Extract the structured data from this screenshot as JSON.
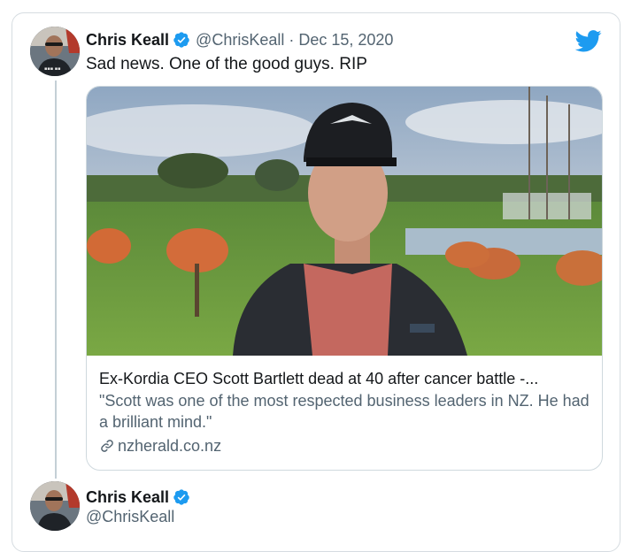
{
  "tweet": {
    "author_name": "Chris Keall",
    "handle": "@ChrisKeall",
    "separator": "·",
    "date": "Dec 15, 2020",
    "text": "Sad news. One of the good guys. RIP"
  },
  "card": {
    "title": "Ex-Kordia CEO Scott Bartlett dead at 40 after cancer battle -...",
    "description": "\"Scott was one of the most respected business leaders in NZ. He had a brilliant mind.\"",
    "domain": "nzherald.co.nz"
  },
  "author_footer": {
    "name": "Chris Keall",
    "handle": "@ChrisKeall"
  },
  "icons": {
    "verified": "verified-badge-icon",
    "brand": "twitter-bird-icon",
    "link": "link-icon"
  },
  "colors": {
    "brand_blue": "#1d9bf0",
    "secondary_text": "#536471",
    "primary_text": "#14171a"
  }
}
